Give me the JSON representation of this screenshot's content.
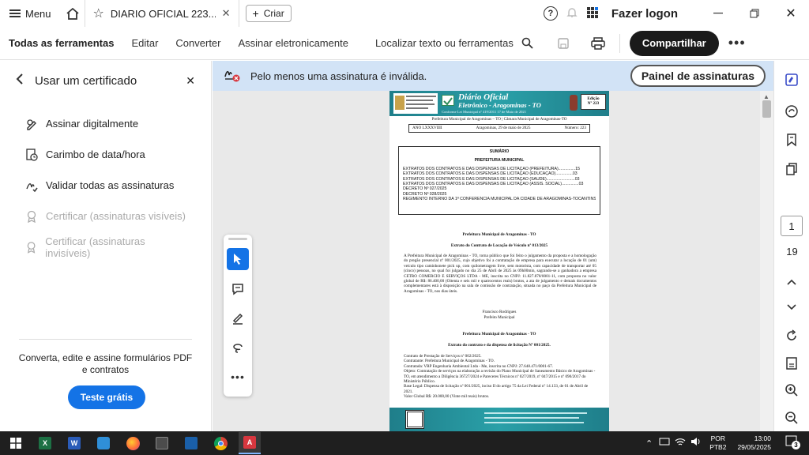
{
  "titlebar": {
    "menu_label": "Menu",
    "tab_title": "DIARIO OFICIAL 223....",
    "new_label": "Criar",
    "login_label": "Fazer logon"
  },
  "toolbar": {
    "items": [
      "Todas as ferramentas",
      "Editar",
      "Converter",
      "Assinar eletronicamente"
    ],
    "search_label": "Localizar texto ou ferramentas",
    "share_label": "Compartilhar"
  },
  "leftpanel": {
    "title": "Usar um certificado",
    "items": [
      {
        "label": "Assinar digitalmente",
        "enabled": true,
        "icon": "sign-pen-icon"
      },
      {
        "label": "Carimbo de data/hora",
        "enabled": true,
        "icon": "timestamp-icon"
      },
      {
        "label": "Validar todas as assinaturas",
        "enabled": true,
        "icon": "validate-signature-icon"
      },
      {
        "label": "Certificar (assinaturas visíveis)",
        "enabled": false,
        "icon": "certify-visible-icon"
      },
      {
        "label": "Certificar (assinaturas invisíveis)",
        "enabled": false,
        "icon": "certify-invisible-icon"
      }
    ],
    "promo": "Converta, edite e assine formulários PDF e contratos",
    "trial_label": "Teste grátis"
  },
  "banner": {
    "message": "Pelo menos uma assinatura é inválida.",
    "panel_label": "Painel de assinaturas"
  },
  "pager": {
    "current": "1",
    "total": "19"
  },
  "document": {
    "brand_line1": "Diário Oficial",
    "brand_line2": "Eletrônico - Aragominas - TO",
    "head_small": "Conforme Lei Municipal nº 419/2011 17 de Maio de 2021",
    "edition_label": "Edição",
    "edition_number": "Nº 223",
    "org_line": "Prefeitura Municipal de Aragominas – TO | Câmara Municipal de Aragominas-TO",
    "year": "ANO LXXXVIIII",
    "date": "Aragominas, 29 de maio de 2025",
    "number": "Número: 223",
    "summary_title": "SUMÁRIO",
    "summary_subtitle": "PREFEITURA MUNICIPAL",
    "summary_items": [
      "EXTRATOS DOS CONTRATOS E DAS DISPENSAS DE LICITAÇÃO (PREFEITURA)...............15",
      "EXTRATOS DOS CONTRATOS E DAS DISPENSAS DE LICITAÇÃO (EDUCAÇÃO)...............03",
      "EXTRATOS DOS CONTRATOS E DAS DISPENSAS DE LICITAÇÃO (SAÚDE).........................03",
      "EXTRATOS DOS CONTRATOS E DAS DISPENSAS DE LICITAÇÃO (ASSIS. SOCIAL)...............03",
      "DECRETO Nº 027/2025",
      "DECRETO Nº 028/2025",
      "REGIMENTO INTERNO DA 1ª CONFERÊNCIA MUNICIPAL DA CIDADE DE ARAGOMINAS-TOCANTINS"
    ],
    "sec1_org": "Prefeitura Municipal de Aragominas - TO",
    "sec1_title": "Extrato do Contrato de Locação de Veículo nº 013/2025",
    "sec1_body": "A Prefeitura Municipal de Aragominas - TO, torna público que foi feito o julgamento da proposta e a homologação do pregão presencial nº 001/2025, cujo objetivo foi a contratação de empresa para executar a locação de 01 (um) veículo tipo caminhonete pick up, com quilometragem livre, sem motorista, com capacidade de transportar até 05 (cinco) pessoas, no qual foi julgado no dia 25 de Abril de 2025 às 09h00min, sagrando-se a ganhadora a empresa CETRO COMERCIO E SERVIÇOS LTDA - ME, inscrita no CNPJ: 11.827.878/0001-11, com proposta no valor global de R$: 86.400,00 (Oitenta e seis mil e quatrocentos reais) brutos, a ata de julgamento e demais documentos complementares está à disposição na sala de comissão de contratação, situada no paço da Prefeitura Municipal de Aragominas - TO, nos dias úteis.",
    "sec1_sign": "Francisco Rodrigues",
    "sec1_role": "Prefeito Municipal",
    "sec2_org": "Prefeitura Municipal de Aragominas - TO",
    "sec2_title": "Extrato do contrato e da dispensa de licitação Nº 001/2025.",
    "sec2_lines": [
      "Contrato de Prestação de Serviços nº 002/2025.",
      "Contratante: Prefeitura Municipal de Aragominas - TO.",
      "Contratada: VRP Engenharia Ambiental Ltda - Me, inscrita no CNPJ: 27.648.471/0001-67.",
      "Objeto: Contratação de serviços na elaboração a revisão do Plano Municipal de Saneamento Básico de Aragominas - TO, em atendimento a Diligência 36727/2024 e Pareceres Técnicos nº 027/2019, nº 047/2015 e nº 090/2017 do Ministério Público.",
      "Base Legal: Dispensa de licitação nº 001/2025, inciso II do artigo 75 da Lei Federal nº 14.133, de 01 de Abril de 2021.",
      "Valor Global R$: 20.000,00 (Vinte mil reais) brutos."
    ]
  },
  "taskbar": {
    "lang1": "POR",
    "lang2": "PTB2",
    "time": "13:00",
    "date": "29/05/2025",
    "notif_count": "3"
  },
  "colors": {
    "accent": "#1473e6",
    "banner": "#d2e3f6",
    "doc_header": "#1f8a95",
    "taskbar": "#1f1f1f"
  }
}
